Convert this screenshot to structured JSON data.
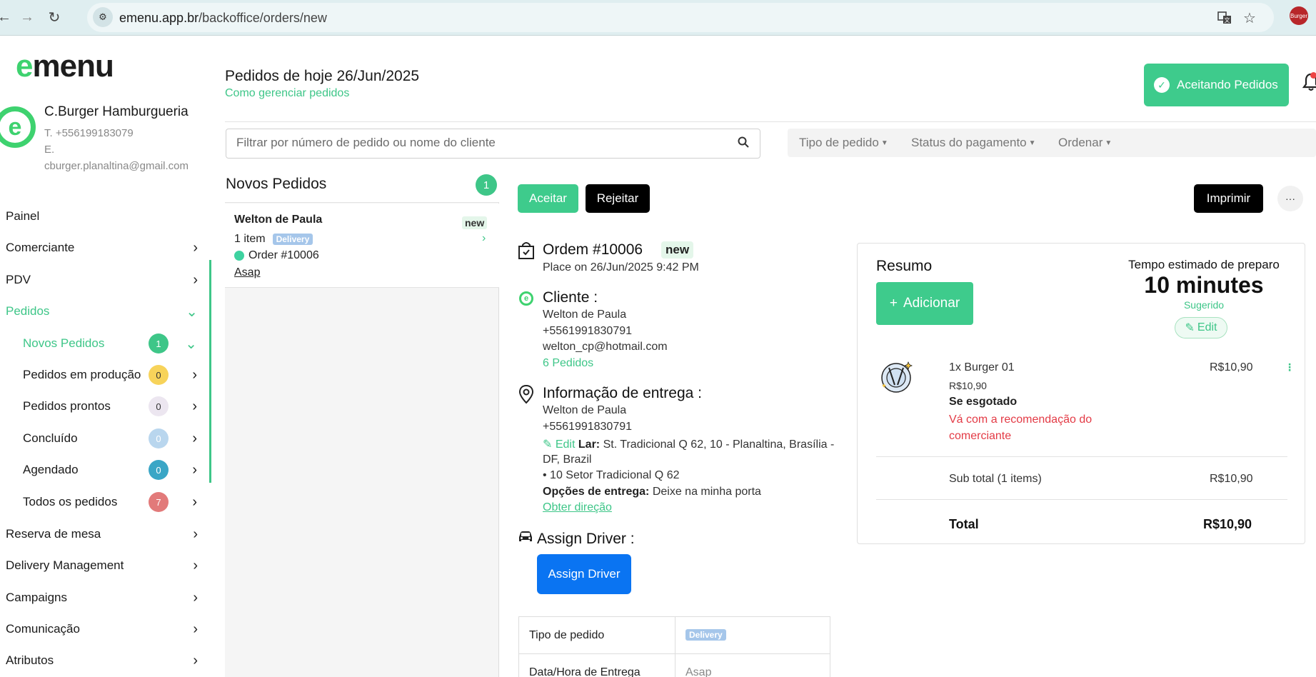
{
  "browser": {
    "back": "←",
    "forward": "→",
    "reload": "↻",
    "url_domain": "emenu.app.br",
    "url_path": "/backoffice/orders/new",
    "translate_icon": "translate-icon",
    "star_icon": "star-icon",
    "avatar_text": "Burger"
  },
  "sidebar": {
    "logo_e": "e",
    "logo_rest": "menu",
    "store": {
      "logo_letter": "e",
      "name": "C.Burger Hamburgueria",
      "phone": "T. +556199183079",
      "email_label": "E.",
      "email": "cburger.planaltina@gmail.com"
    },
    "menu": [
      {
        "label": "Painel"
      },
      {
        "label": "Comerciante"
      },
      {
        "label": "PDV"
      },
      {
        "label": "Pedidos"
      },
      {
        "label": "Reserva de mesa"
      },
      {
        "label": "Delivery Management"
      },
      {
        "label": "Campaigns"
      },
      {
        "label": "Comunicação"
      },
      {
        "label": "Atributos"
      }
    ],
    "submenu": [
      {
        "label": "Novos Pedidos",
        "count": "1",
        "color": "#3ec688"
      },
      {
        "label": "Pedidos em produção",
        "count": "0",
        "color": "#f7d35a"
      },
      {
        "label": "Pedidos prontos",
        "count": "0",
        "color": "#e8e2ec"
      },
      {
        "label": "Concluído",
        "count": "0",
        "color": "#b9d6ee"
      },
      {
        "label": "Agendado",
        "count": "0",
        "color": "#3aa6c6"
      },
      {
        "label": "Todos os pedidos",
        "count": "7",
        "color": "#e27a7a"
      }
    ]
  },
  "header": {
    "title": "Pedidos de hoje 26/Jun/2025",
    "subtitle": "Como gerenciar pedidos",
    "accept_toggle": "Aceitando Pedidos"
  },
  "search": {
    "placeholder": "Filtrar por número de pedido ou nome do cliente"
  },
  "filters": {
    "type": "Tipo de pedido",
    "payment": "Status do pagamento",
    "sort": "Ordenar"
  },
  "orders_list": {
    "title": "Novos Pedidos",
    "count": "1",
    "card": {
      "name": "Welton de Paula",
      "status": "new",
      "items": "1 item",
      "tag": "Delivery",
      "order": "Order #10006",
      "time": "Asap"
    }
  },
  "detail": {
    "accept": "Aceitar",
    "reject": "Rejeitar",
    "print": "Imprimir",
    "more": "···",
    "order_title": "Ordem #10006",
    "order_status": "new",
    "placed": "Place on 26/Jun/2025 9:42 PM",
    "client": {
      "heading": "Cliente :",
      "name": "Welton de Paula",
      "phone": "+5561991830791",
      "email": "welton_cp@hotmail.com",
      "orders_link": "6 Pedidos"
    },
    "delivery": {
      "heading": "Informação de entrega :",
      "name": "Welton de Paula",
      "phone": "+5561991830791",
      "edit": "Edit",
      "address_label": "Lar:",
      "address_line1": "St. Tradicional Q 62, 10 - Planaltina, Brasília -",
      "address_line2": "DF, Brazil",
      "address_line3": "• 10 Setor Tradicional Q 62",
      "options_label": "Opções de entrega:",
      "options_value": "Deixe na minha porta",
      "directions": "Obter direção"
    },
    "driver": {
      "heading": "Assign Driver :",
      "button": "Assign Driver"
    },
    "table": {
      "row1_label": "Tipo de pedido",
      "row1_value": "Delivery",
      "row2_label": "Data/Hora de Entrega",
      "row2_value": "Asap"
    }
  },
  "summary": {
    "title": "Resumo",
    "add_button": "Adicionar",
    "prep_label": "Tempo estimado de preparo",
    "prep_value": "10 minutes",
    "prep_suggested": "Sugerido",
    "edit": "Edit",
    "item": {
      "name": "1x Burger 01",
      "unit_price": "R$10,90",
      "price": "R$10,90",
      "note_title": "Se esgotado",
      "note_text": "Vá com a recomendação do comerciante"
    },
    "subtotal_label": "Sub total (1 items)",
    "subtotal_value": "R$10,90",
    "total_label": "Total",
    "total_value": "R$10,90"
  }
}
